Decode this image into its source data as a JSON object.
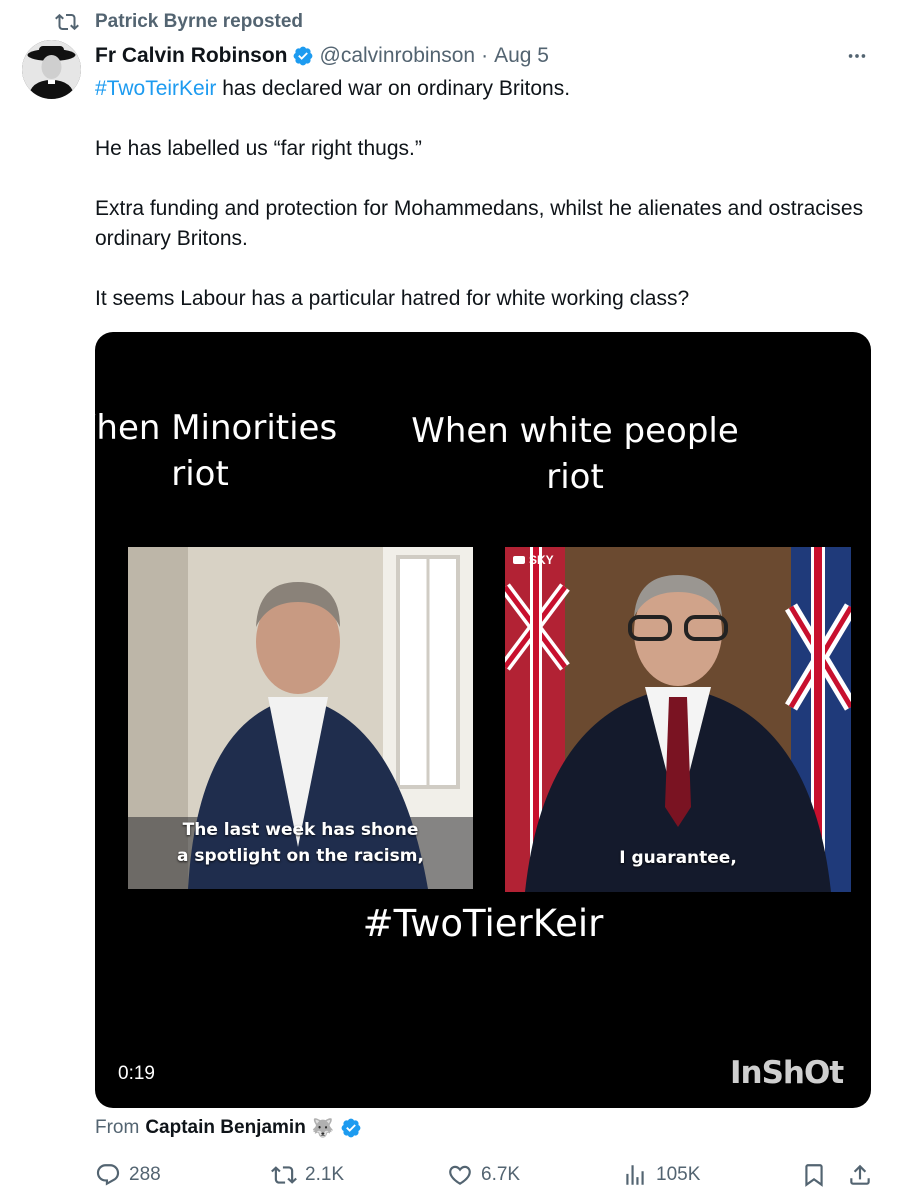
{
  "repost": {
    "label": "Patrick Byrne reposted",
    "icon": "repost-icon"
  },
  "author": {
    "display_name": "Fr Calvin Robinson",
    "handle": "@calvinrobinson",
    "separator": "·",
    "date": "Aug 5",
    "verified_color": "#1d9bf0"
  },
  "tweet": {
    "hashtag": "#TwoTeirKeir",
    "line1_rest": " has declared war on ordinary Britons.",
    "para2": "He has labelled us “far right thugs.”",
    "para3": "Extra funding and protection for Mohammedans, whilst he alienates and ostracises ordinary Britons.",
    "para4": "It seems Labour has a particular hatred for white working class?"
  },
  "media": {
    "caption_left": "When Minorities riot",
    "caption_right": "When white people riot",
    "subtitle_left_1": "The last week has shone",
    "subtitle_left_2": "a spotlight on the racism,",
    "subtitle_right": "I guarantee,",
    "channel_badge": "SKY",
    "hashtag_overlay": "#TwoTierKeir",
    "duration": "0:19",
    "watermark": "InShOt"
  },
  "source": {
    "prefix": "From",
    "name": "Captain Benjamin",
    "emoji": "🐺"
  },
  "actions": {
    "replies": "288",
    "reposts": "2.1K",
    "likes": "6.7K",
    "views": "105K"
  },
  "colors": {
    "link": "#1d9bf0",
    "secondary": "#536471",
    "text": "#0f1419"
  }
}
